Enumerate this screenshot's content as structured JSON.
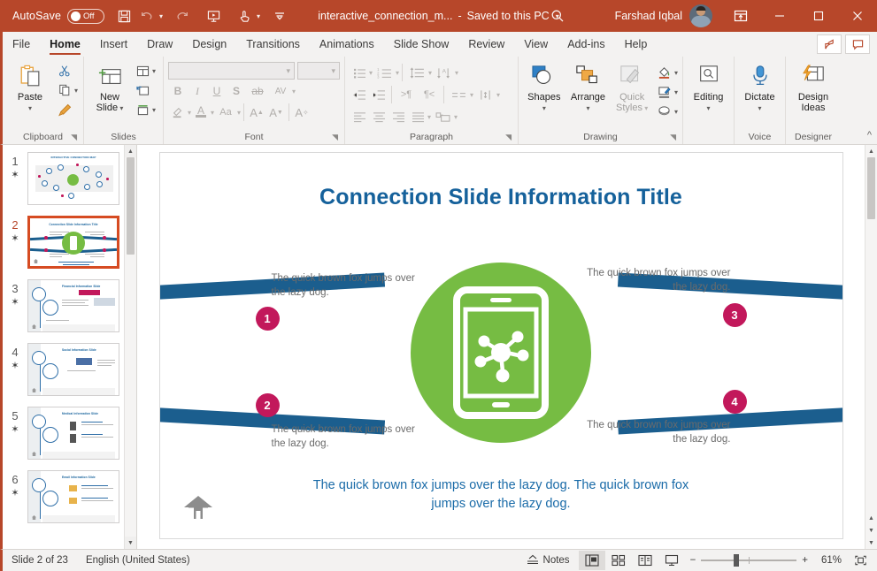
{
  "titlebar": {
    "autosave_label": "AutoSave",
    "autosave_state": "Off",
    "doc_title": "interactive_connection_m...",
    "save_state": "Saved to this PC",
    "user_name": "Farshad Iqbal",
    "icons": [
      "save-icon",
      "undo-icon",
      "redo-icon",
      "start-presentation-icon",
      "touch-mode-icon",
      "customize-toolbar-icon"
    ],
    "search_icon": "search-icon",
    "ribbon_display_icon": "ribbon-display-options-icon",
    "minimize": "minimize-icon",
    "maximize": "maximize-icon",
    "close": "close-icon"
  },
  "ribbon": {
    "tabs": [
      {
        "label": "File",
        "active": false
      },
      {
        "label": "Home",
        "active": true
      },
      {
        "label": "Insert",
        "active": false
      },
      {
        "label": "Draw",
        "active": false
      },
      {
        "label": "Design",
        "active": false
      },
      {
        "label": "Transitions",
        "active": false
      },
      {
        "label": "Animations",
        "active": false
      },
      {
        "label": "Slide Show",
        "active": false
      },
      {
        "label": "Review",
        "active": false
      },
      {
        "label": "View",
        "active": false
      },
      {
        "label": "Add-ins",
        "active": false
      },
      {
        "label": "Help",
        "active": false
      }
    ],
    "share_label": "share-icon",
    "comments_label": "comments-icon",
    "collapse_label": "^",
    "groups": {
      "clipboard": {
        "label": "Clipboard",
        "paste": "Paste",
        "cut": "cut-icon",
        "copy": "copy-icon",
        "format_painter": "format-painter-icon"
      },
      "slides": {
        "label": "Slides",
        "new_slide": "New\nSlide",
        "new_slide_line1": "New",
        "new_slide_line2": "Slide",
        "layout": "layout-icon",
        "reset": "reset-icon",
        "section": "section-icon"
      },
      "font": {
        "label": "Font",
        "font_name_value": "",
        "font_size_value": "",
        "bold": "B",
        "italic": "I",
        "underline": "U",
        "shadow": "S",
        "strikethrough": "ab",
        "char_spacing": "AV",
        "text_highlight": "text-highlight-icon",
        "font_color": "A",
        "change_case": "Aa",
        "increase_size": "A",
        "decrease_size": "A",
        "clear_formatting": "clear-formatting-icon"
      },
      "paragraph": {
        "label": "Paragraph",
        "bullets": "bullets-icon",
        "numbering": "numbering-icon",
        "line_spacing": "line-spacing-icon",
        "text_direction": "text-direction-icon",
        "decrease_indent": "decrease-indent-icon",
        "increase_indent": "increase-indent-icon",
        "ltr": "ltr-icon",
        "rtl": "rtl-icon",
        "columns": "columns-icon",
        "align_text": "align-text-icon",
        "align_left": "align-left-icon",
        "align_center": "align-center-icon",
        "align_right": "align-right-icon",
        "justify": "justify-icon",
        "smartart": "convert-to-smartart-icon"
      },
      "drawing": {
        "label": "Drawing",
        "shapes": "Shapes",
        "arrange": "Arrange",
        "quick_styles_line1": "Quick",
        "quick_styles_line2": "Styles",
        "shape_fill": "shape-fill-icon",
        "shape_outline": "shape-outline-icon",
        "shape_effects": "shape-effects-icon"
      },
      "editing": {
        "label": "",
        "editing": "Editing"
      },
      "voice": {
        "label": "Voice",
        "dictate": "Dictate"
      },
      "designer": {
        "label": "Designer",
        "design_ideas_line1": "Design",
        "design_ideas_line2": "Ideas"
      }
    }
  },
  "thumbnails": [
    {
      "number": "1",
      "animated": true,
      "selected": false,
      "title": "INTERACTIVE CONNECTION MAP",
      "kind": "map"
    },
    {
      "number": "2",
      "animated": true,
      "selected": true,
      "title": "Connection Slide Information Title",
      "kind": "connection"
    },
    {
      "number": "3",
      "animated": true,
      "selected": false,
      "title": "Financial Information Slide",
      "kind": "info"
    },
    {
      "number": "4",
      "animated": true,
      "selected": false,
      "title": "Social Information Slide",
      "kind": "info"
    },
    {
      "number": "5",
      "animated": true,
      "selected": false,
      "title": "Medical Information Slide",
      "kind": "info"
    },
    {
      "number": "6",
      "animated": true,
      "selected": false,
      "title": "Email Information Slide",
      "kind": "info"
    }
  ],
  "slide": {
    "title": "Connection Slide Information Title",
    "center_icon": "smartphone-network-icon",
    "markers": [
      {
        "number": "1",
        "caption": "The quick brown fox jumps over the lazy dog.",
        "position": "top-left"
      },
      {
        "number": "2",
        "caption": "The quick brown fox jumps over the lazy dog.",
        "position": "bottom-left"
      },
      {
        "number": "3",
        "caption": "The quick brown fox jumps over the lazy dog.",
        "position": "top-right"
      },
      {
        "number": "4",
        "caption": "The quick brown fox jumps over the lazy dog.",
        "position": "bottom-right"
      }
    ],
    "bottom_caption": "The quick brown fox jumps over the lazy dog. The quick brown fox jumps over the lazy dog.",
    "home_icon": "home-icon",
    "colors": {
      "title_blue": "#15619b",
      "band_blue": "#1B5E8E",
      "marker_crimson": "#C2185B",
      "circle_green": "#76BC43",
      "caption_gray": "#6b6b6b",
      "bottom_caption_blue": "#1a6ba8"
    }
  },
  "statusbar": {
    "slide_count": "Slide 2 of 23",
    "language": "English (United States)",
    "notes_label": "Notes",
    "notes_icon": "notes-icon",
    "views": [
      {
        "name": "normal-view",
        "icon": "normal-view-icon",
        "active": true
      },
      {
        "name": "slide-sorter-view",
        "icon": "slide-sorter-icon",
        "active": false
      },
      {
        "name": "reading-view",
        "icon": "reading-view-icon",
        "active": false
      },
      {
        "name": "slide-show-view",
        "icon": "slide-show-icon",
        "active": false
      }
    ],
    "zoom_out": "−",
    "zoom_in": "+",
    "zoom_level": "61%",
    "fit_slide_icon": "fit-to-window-icon"
  }
}
